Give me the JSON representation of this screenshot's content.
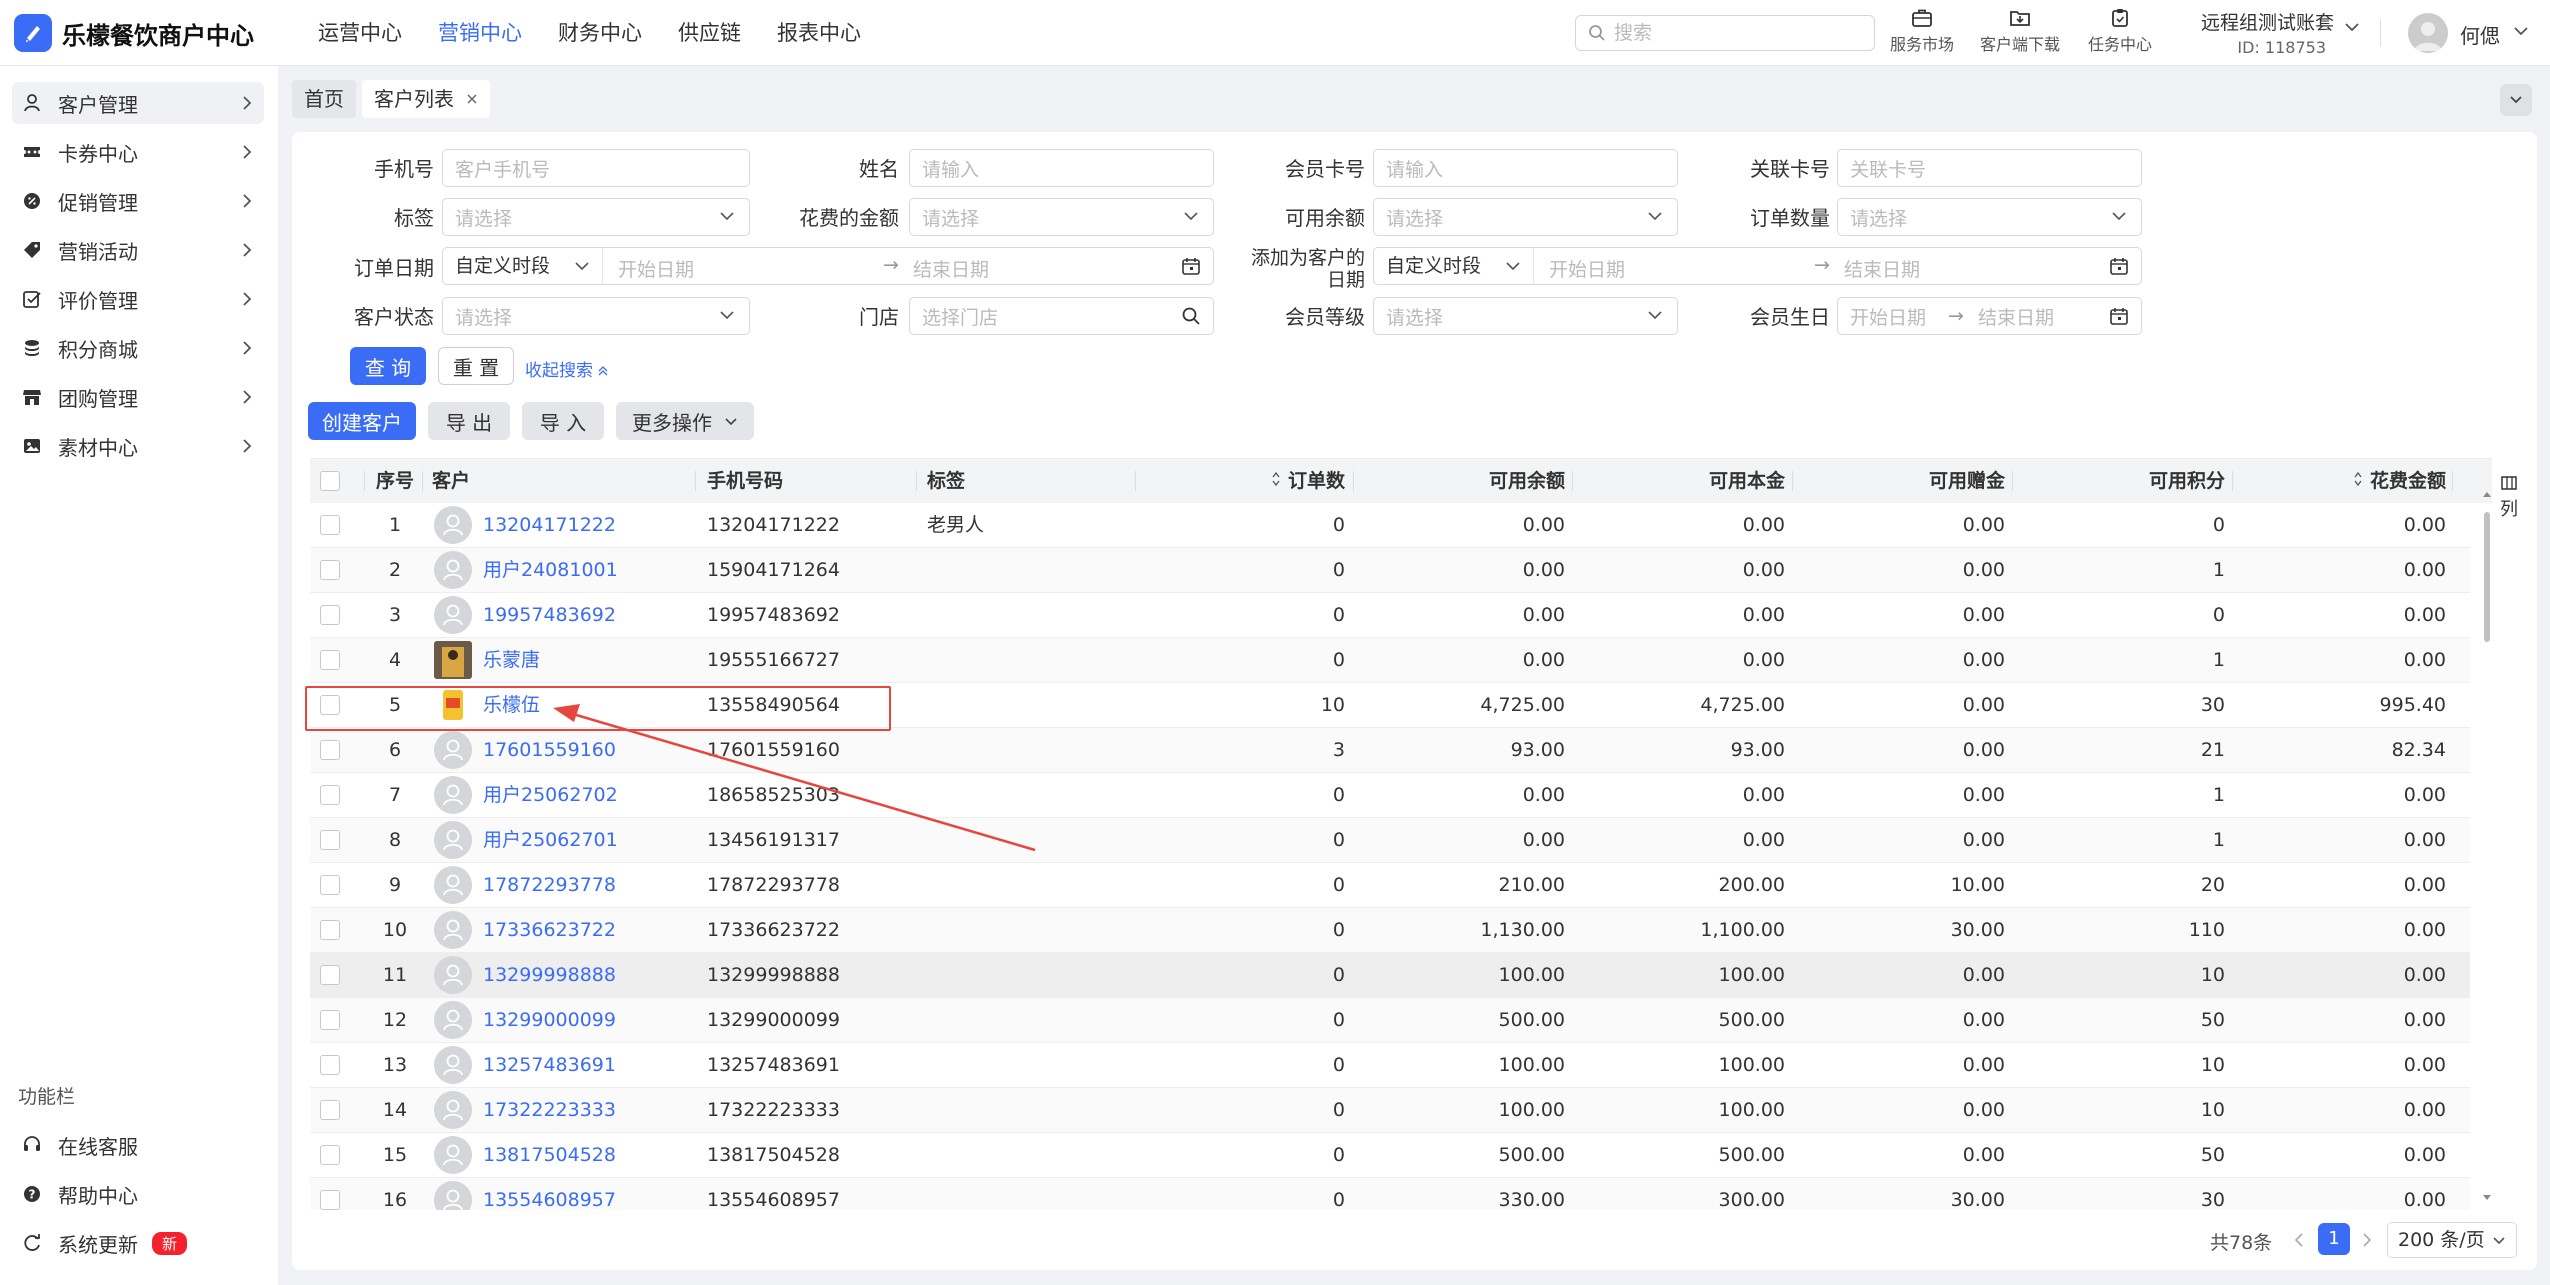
{
  "app": {
    "brand": "乐檬餐饮商户中心"
  },
  "topnav": [
    {
      "label": "运营中心",
      "active": false
    },
    {
      "label": "营销中心",
      "active": true
    },
    {
      "label": "财务中心",
      "active": false
    },
    {
      "label": "供应链",
      "active": false
    },
    {
      "label": "报表中心",
      "active": false
    }
  ],
  "search": {
    "placeholder": "搜索"
  },
  "tools": {
    "market": "服务市场",
    "download": "客户端下载",
    "tasks": "任务中心"
  },
  "account": {
    "name": "远程组测试账套",
    "id": "ID: 118753"
  },
  "user": {
    "name": "何偲"
  },
  "sidebar": {
    "items": [
      {
        "label": "客户管理",
        "icon": "user-icon"
      },
      {
        "label": "卡券中心",
        "icon": "ticket-icon"
      },
      {
        "label": "促销管理",
        "icon": "promo-icon"
      },
      {
        "label": "营销活动",
        "icon": "tag-icon"
      },
      {
        "label": "评价管理",
        "icon": "review-icon"
      },
      {
        "label": "积分商城",
        "icon": "coins-icon"
      },
      {
        "label": "团购管理",
        "icon": "store-icon"
      },
      {
        "label": "素材中心",
        "icon": "image-icon"
      }
    ],
    "section_title": "功能栏",
    "bottom": [
      {
        "label": "在线客服",
        "icon": "headset-icon"
      },
      {
        "label": "帮助中心",
        "icon": "help-icon"
      },
      {
        "label": "系统更新",
        "icon": "update-icon",
        "badge": "新"
      }
    ]
  },
  "tabs": [
    {
      "label": "首页"
    },
    {
      "label": "客户列表"
    }
  ],
  "filters": {
    "phone": {
      "label": "手机号",
      "placeholder": "客户手机号"
    },
    "name": {
      "label": "姓名",
      "placeholder": "请输入"
    },
    "card": {
      "label": "会员卡号",
      "placeholder": "请输入"
    },
    "linked": {
      "label": "关联卡号",
      "placeholder": "关联卡号"
    },
    "tag": {
      "label": "标签",
      "placeholder": "请选择"
    },
    "spent": {
      "label": "花费的金额",
      "placeholder": "请选择"
    },
    "balance": {
      "label": "可用余额",
      "placeholder": "请选择"
    },
    "orders": {
      "label": "订单数量",
      "placeholder": "请选择"
    },
    "order_date": {
      "label": "订单日期",
      "mode": "自定义时段",
      "start": "开始日期",
      "end": "结束日期"
    },
    "added_date": {
      "label1": "添加为客户的",
      "label2": "日期",
      "mode": "自定义时段",
      "start": "开始日期",
      "end": "结束日期"
    },
    "status": {
      "label": "客户状态",
      "placeholder": "请选择"
    },
    "store": {
      "label": "门店",
      "placeholder": "选择门店"
    },
    "level": {
      "label": "会员等级",
      "placeholder": "请选择"
    },
    "birthday": {
      "label": "会员生日",
      "start": "开始日期",
      "end": "结束日期"
    }
  },
  "buttons": {
    "query": "查 询",
    "reset": "重 置",
    "collapse": "收起搜索",
    "create": "创建客户",
    "export": "导 出",
    "import": "导 入",
    "more": "更多操作"
  },
  "table": {
    "headers": {
      "index": "序号",
      "customer": "客户",
      "phone": "手机号码",
      "tag": "标签",
      "orders": "订单数",
      "balance": "可用余额",
      "principal": "可用本金",
      "gift": "可用赠金",
      "points": "可用积分",
      "spent": "花费金额"
    },
    "col_toggle": "列",
    "rows": [
      {
        "idx": "1",
        "name": "13204171222",
        "phone": "13204171222",
        "tag": "老男人",
        "orders": "0",
        "balance": "0.00",
        "principal": "0.00",
        "gift": "0.00",
        "points": "0",
        "spent": "0.00"
      },
      {
        "idx": "2",
        "name": "用户24081001",
        "phone": "15904171264",
        "tag": "",
        "orders": "0",
        "balance": "0.00",
        "principal": "0.00",
        "gift": "0.00",
        "points": "1",
        "spent": "0.00"
      },
      {
        "idx": "3",
        "name": "19957483692",
        "phone": "19957483692",
        "tag": "",
        "orders": "0",
        "balance": "0.00",
        "principal": "0.00",
        "gift": "0.00",
        "points": "0",
        "spent": "0.00"
      },
      {
        "idx": "4",
        "name": "乐蒙唐",
        "phone": "19555166727",
        "tag": "",
        "orders": "0",
        "balance": "0.00",
        "principal": "0.00",
        "gift": "0.00",
        "points": "1",
        "spent": "0.00"
      },
      {
        "idx": "5",
        "name": "乐檬伍",
        "phone": "13558490564",
        "tag": "",
        "orders": "10",
        "balance": "4,725.00",
        "principal": "4,725.00",
        "gift": "0.00",
        "points": "30",
        "spent": "995.40"
      },
      {
        "idx": "6",
        "name": "17601559160",
        "phone": "17601559160",
        "tag": "",
        "orders": "3",
        "balance": "93.00",
        "principal": "93.00",
        "gift": "0.00",
        "points": "21",
        "spent": "82.34"
      },
      {
        "idx": "7",
        "name": "用户25062702",
        "phone": "18658525303",
        "tag": "",
        "orders": "0",
        "balance": "0.00",
        "principal": "0.00",
        "gift": "0.00",
        "points": "1",
        "spent": "0.00"
      },
      {
        "idx": "8",
        "name": "用户25062701",
        "phone": "13456191317",
        "tag": "",
        "orders": "0",
        "balance": "0.00",
        "principal": "0.00",
        "gift": "0.00",
        "points": "1",
        "spent": "0.00"
      },
      {
        "idx": "9",
        "name": "17872293778",
        "phone": "17872293778",
        "tag": "",
        "orders": "0",
        "balance": "210.00",
        "principal": "200.00",
        "gift": "10.00",
        "points": "20",
        "spent": "0.00"
      },
      {
        "idx": "10",
        "name": "17336623722",
        "phone": "17336623722",
        "tag": "",
        "orders": "0",
        "balance": "1,130.00",
        "principal": "1,100.00",
        "gift": "30.00",
        "points": "110",
        "spent": "0.00"
      },
      {
        "idx": "11",
        "name": "13299998888",
        "phone": "13299998888",
        "tag": "",
        "orders": "0",
        "balance": "100.00",
        "principal": "100.00",
        "gift": "0.00",
        "points": "10",
        "spent": "0.00"
      },
      {
        "idx": "12",
        "name": "13299000099",
        "phone": "13299000099",
        "tag": "",
        "orders": "0",
        "balance": "500.00",
        "principal": "500.00",
        "gift": "0.00",
        "points": "50",
        "spent": "0.00"
      },
      {
        "idx": "13",
        "name": "13257483691",
        "phone": "13257483691",
        "tag": "",
        "orders": "0",
        "balance": "100.00",
        "principal": "100.00",
        "gift": "0.00",
        "points": "10",
        "spent": "0.00"
      },
      {
        "idx": "14",
        "name": "17322223333",
        "phone": "17322223333",
        "tag": "",
        "orders": "0",
        "balance": "100.00",
        "principal": "100.00",
        "gift": "0.00",
        "points": "10",
        "spent": "0.00"
      },
      {
        "idx": "15",
        "name": "13817504528",
        "phone": "13817504528",
        "tag": "",
        "orders": "0",
        "balance": "500.00",
        "principal": "500.00",
        "gift": "0.00",
        "points": "50",
        "spent": "0.00"
      },
      {
        "idx": "16",
        "name": "13554608957",
        "phone": "13554608957",
        "tag": "",
        "orders": "0",
        "balance": "330.00",
        "principal": "300.00",
        "gift": "30.00",
        "points": "30",
        "spent": "0.00"
      }
    ]
  },
  "pagination": {
    "total": "共78条",
    "page": "1",
    "size": "200 条/页"
  },
  "colors": {
    "accent": "#3b6cf6",
    "highlight": "#e5463f",
    "badge": "#f5222d"
  }
}
